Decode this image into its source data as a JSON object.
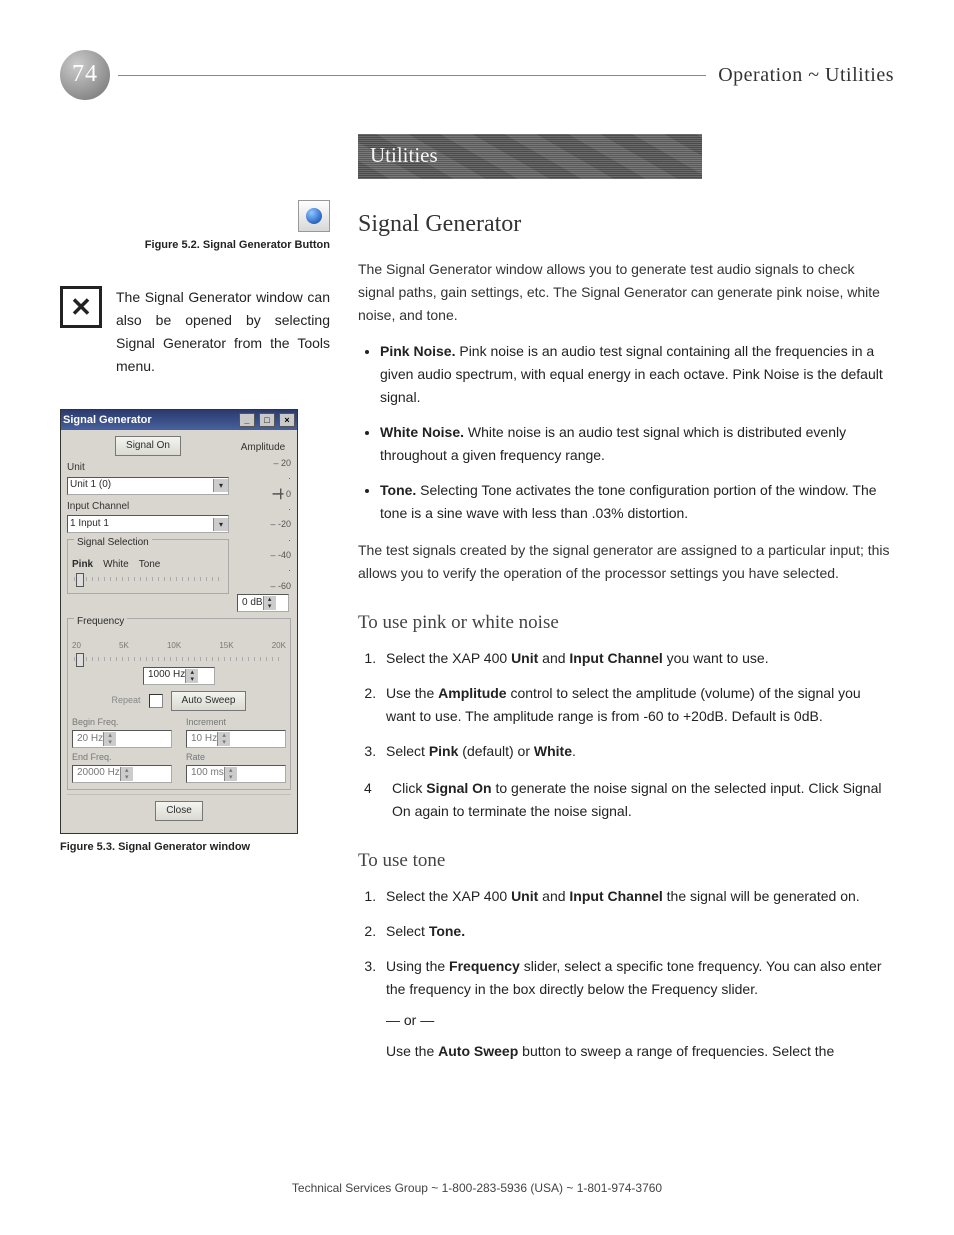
{
  "header": {
    "page_number": "74",
    "breadcrumb_section": "Operation",
    "breadcrumb_sep": "~",
    "breadcrumb_sub": "Utilities"
  },
  "banner": {
    "title": "Utilities"
  },
  "sidebar": {
    "fig_button_caption": "Figure 5.2. Signal Generator Button",
    "tip": {
      "text": "The Signal Generator window can also be opened by selecting Signal Generator from the Tools menu."
    },
    "fig_window_caption": "Figure 5.3. Signal Generator window",
    "mock": {
      "title": "Signal Generator",
      "signal_on": "Signal On",
      "amplitude_label": "Amplitude",
      "amp_tick_top": "– 20",
      "amp_tick_0": "0",
      "amp_tick_m20": "– -20",
      "amp_tick_m40": "– -40",
      "amp_tick_m60": "– -60",
      "amp_value": "0 dB",
      "unit_label": "Unit",
      "unit_value": "Unit 1  (0)",
      "input_channel_label": "Input Channel",
      "input_channel_value": "1 Input 1",
      "signal_selection_label": "Signal Selection",
      "signal_pink": "Pink",
      "signal_white": "White",
      "signal_tone": "Tone",
      "frequency_label": "Frequency",
      "freq_ticks": [
        "20",
        "5K",
        "10K",
        "15K",
        "20K"
      ],
      "freq_value": "1000 Hz",
      "repeat_label": "Repeat",
      "auto_sweep": "Auto Sweep",
      "begin_freq_label": "Begin Freq.",
      "begin_freq_value": "20 Hz",
      "increment_label": "Increment",
      "increment_value": "10 Hz",
      "end_freq_label": "End Freq.",
      "end_freq_value": "20000 Hz",
      "rate_label": "Rate",
      "rate_value": "100 ms",
      "close": "Close"
    }
  },
  "main": {
    "h1": "Signal Generator",
    "intro": "The Signal Generator window allows you to generate test audio signals to check signal paths, gain settings, etc. The Signal Generator can generate pink noise, white noise, and tone.",
    "bullets": {
      "pink_label": "Pink Noise.",
      "pink_text": " Pink noise is an audio test signal containing all the frequencies in a given audio spectrum, with equal energy in each octave. Pink Noise is the default signal.",
      "white_label": "White Noise.",
      "white_text": " White noise is an audio test signal which is distributed evenly throughout a given frequency range.",
      "tone_label": "Tone.",
      "tone_text": " Selecting Tone activates the tone configuration portion of the window. The tone is a sine wave with less than .03% distortion."
    },
    "after_bullets": "The test signals created by the signal generator are assigned to a particular input; this allows you to verify the operation of the processor settings you have selected.",
    "h2a": "To use pink or white noise",
    "noise_steps": {
      "s1a": "Select the XAP 400 ",
      "s1b": "Unit",
      "s1c": " and ",
      "s1d": "Input Channel",
      "s1e": " you want to use.",
      "s2a": "Use the ",
      "s2b": "Amplitude",
      "s2c": " control to select the amplitude (volume) of the signal you want to use. The amplitude range is from -60 to +20dB. Default is 0dB.",
      "s3a": "Select ",
      "s3b": "Pink",
      "s3c": " (default) or ",
      "s3d": "White",
      "s3e": ".",
      "s4num": "4",
      "s4a": "Click ",
      "s4b": "Signal On",
      "s4c": " to generate the noise signal on the selected input. Click Signal On again to terminate the noise signal."
    },
    "h2b": "To use tone",
    "tone_steps": {
      "t1a": "Select the XAP 400 ",
      "t1b": "Unit",
      "t1c": " and ",
      "t1d": "Input Channel",
      "t1e": " the signal will be generated on.",
      "t2a": "Select ",
      "t2b": "Tone.",
      "t3a": "Using the ",
      "t3b": "Frequency",
      "t3c": " slider, select a specific tone frequency. You can also enter the frequency in the box directly below the Frequency slider.",
      "t3_or": "— or —",
      "t3d": "Use the ",
      "t3e": "Auto Sweep",
      "t3f": " button to sweep a range of frequencies. Select the"
    }
  },
  "footer": {
    "text": "Technical Services Group ~ 1-800-283-5936 (USA) ~ 1-801-974-3760"
  }
}
